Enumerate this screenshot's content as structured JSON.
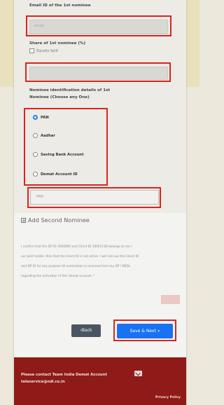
{
  "form": {
    "email_label": "Email ID of the 1st nominee",
    "email_placeholder": "email",
    "share_label": "Share of 1st nominee (%)",
    "share_checkbox_label": "Equally Split",
    "share_value": "",
    "id_details_label_line1": "Nominee identification details of 1st",
    "id_details_label_line2": "Nominee (Choose any One)",
    "id_options": [
      {
        "label": "PAN",
        "selected": true
      },
      {
        "label": "Aadhar",
        "selected": false
      },
      {
        "label": "Saving Bank Account",
        "selected": false
      },
      {
        "label": "Demat Account ID",
        "selected": false
      }
    ],
    "id_input_placeholder": "PAN"
  },
  "add_nominee": {
    "label": "Add Second Nominee"
  },
  "consent": {
    "lines": [
      "I confirm that the DP ID 3000000 and Client ID 10001136 belongs to me /",
      "our joint holder. Also that the Client ID is not active. I will not sue the Client ID",
      "and DP ID for any purpose till nomination is received from my DP / NSDL",
      "regarding the activation of this demat account. *"
    ]
  },
  "buttons": {
    "back": "‹Back",
    "next": "Save & Next »"
  },
  "footer": {
    "contact_line1": "Please contact Team India Demat Account",
    "contact_line2": "teleservice@ndl.co.in",
    "privacy": "Privacy Policy"
  },
  "colors": {
    "highlight": "#d8261c",
    "primary_button": "#1972f0",
    "back_button": "#4b5561",
    "footer": "#8e1b18",
    "radio_selected": "#2a7be0"
  }
}
